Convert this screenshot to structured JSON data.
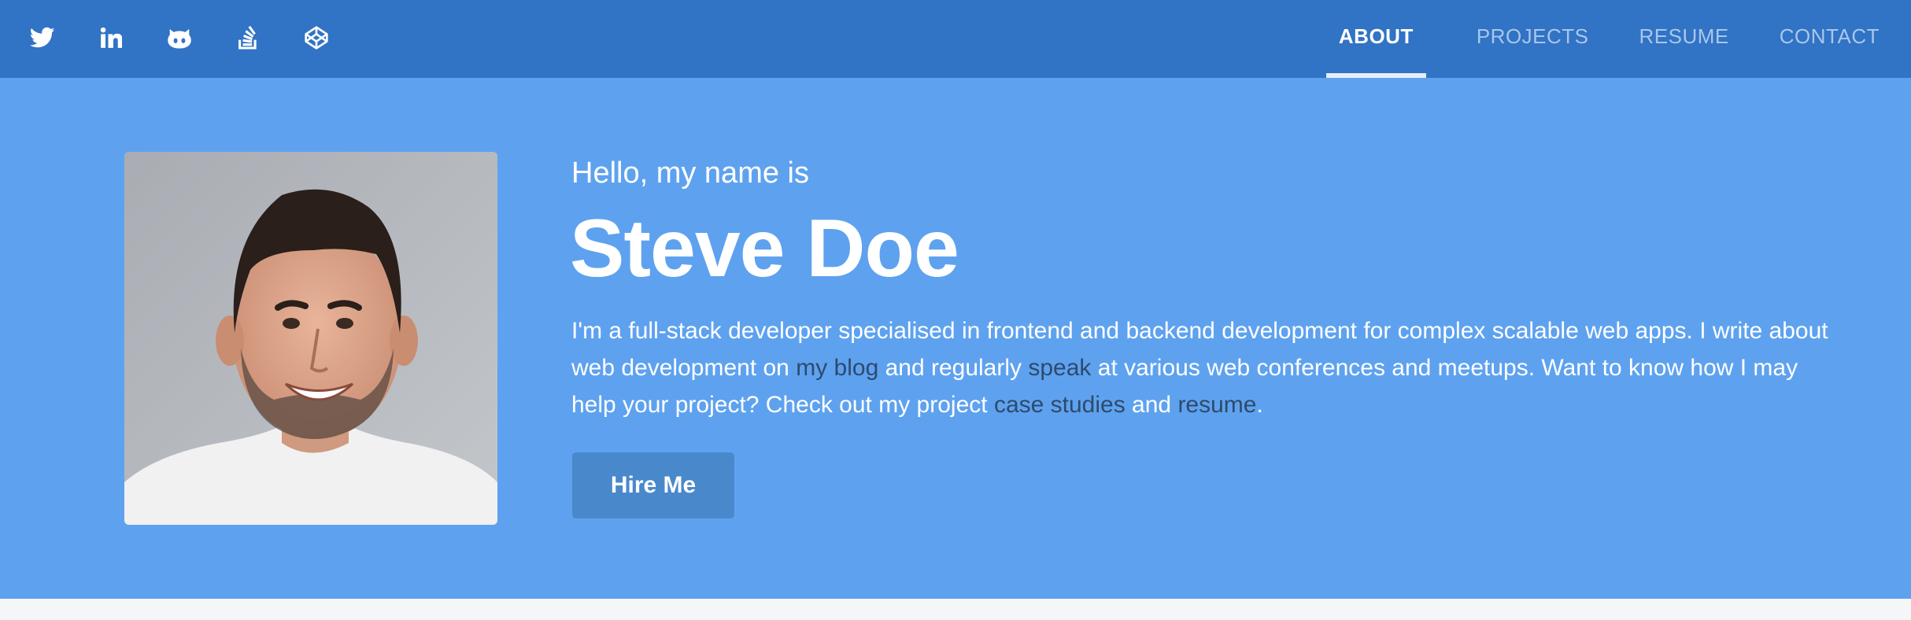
{
  "social": [
    {
      "icon": "twitter-icon",
      "label": "Twitter"
    },
    {
      "icon": "linkedin-icon",
      "label": "LinkedIn"
    },
    {
      "icon": "github-icon",
      "label": "GitHub"
    },
    {
      "icon": "stackoverflow-icon",
      "label": "Stack Overflow"
    },
    {
      "icon": "codepen-icon",
      "label": "CodePen"
    }
  ],
  "nav": {
    "items": [
      {
        "label": "ABOUT",
        "active": true
      },
      {
        "label": "PROJECTS",
        "active": false
      },
      {
        "label": "RESUME",
        "active": false
      },
      {
        "label": "CONTACT",
        "active": false
      }
    ]
  },
  "hero": {
    "greeting": "Hello, my name is",
    "name": "Steve Doe",
    "bio": {
      "part1": "I'm a full-stack developer specialised in frontend and backend development for complex scalable web apps. I write about web development on ",
      "link_blog": "my blog",
      "part2": " and regularly ",
      "link_speak": "speak",
      "part3": " at various web conferences and meetups. Want to know how I may help your project? Check out my project ",
      "link_case_studies": "case studies",
      "part4": " and ",
      "link_resume": "resume",
      "part5": "."
    },
    "hire_button": "Hire Me"
  },
  "colors": {
    "topbar": "#3173c4",
    "hero": "#5ea2ef",
    "button": "#4a88cc",
    "link": "#2e4a6d",
    "nav_inactive": "#a9c6ec"
  }
}
